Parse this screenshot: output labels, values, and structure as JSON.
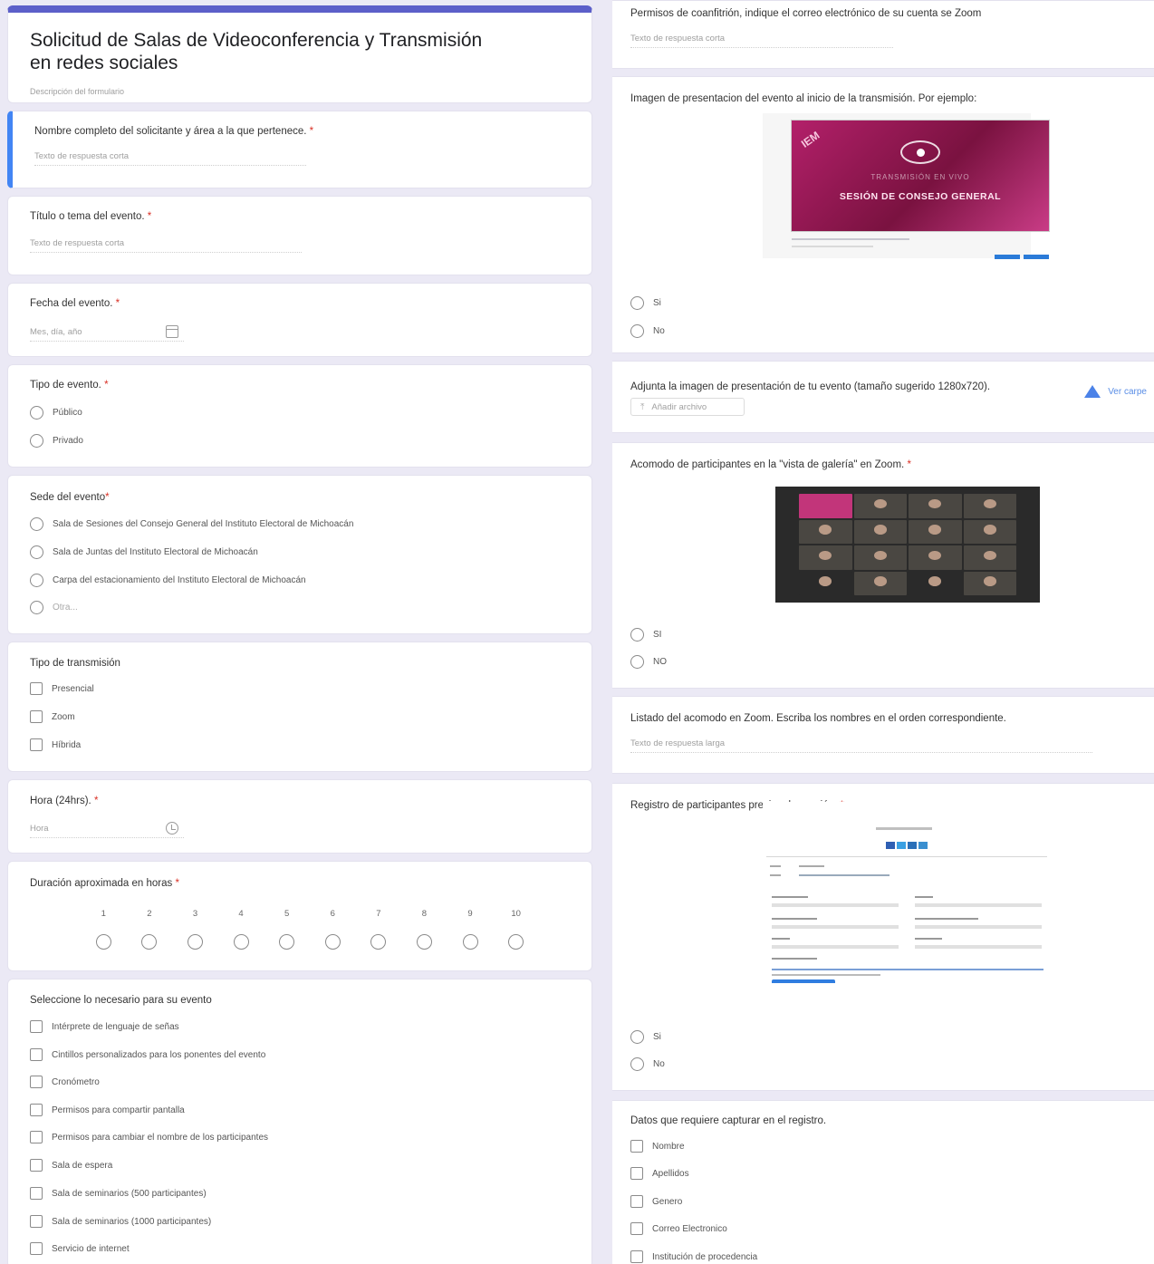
{
  "form": {
    "title": "Solicitud de Salas de Videoconferencia y Transmisión en redes sociales",
    "description_placeholder": "Descripción del formulario",
    "accent_color": "#5c5fc9"
  },
  "left": {
    "q_name": {
      "title": "Nombre completo del solicitante y área a la que pertenece.",
      "req": "*",
      "answer": "Texto de respuesta corta"
    },
    "q_event_title": {
      "title": "Título o tema del evento.",
      "req": "*",
      "answer": "Texto de respuesta corta"
    },
    "q_date": {
      "title": "Fecha del evento.",
      "req": "*",
      "answer": "Mes, día, año",
      "icon": "calendar-icon"
    },
    "q_type": {
      "title": "Tipo de evento.",
      "req": "*",
      "options": [
        "Público",
        "Privado"
      ]
    },
    "q_venue": {
      "title": "Sede del evento",
      "req": "*",
      "options": [
        "Sala de Sesiones del Consejo General del Instituto Electoral de Michoacán",
        "Sala de Juntas del Instituto Electoral de Michoacán",
        "Carpa del estacionamiento del Instituto Electoral de Michoacán",
        "Otra..."
      ]
    },
    "q_transmission": {
      "title": "Tipo de transmisión",
      "options": [
        "Presencial",
        "Zoom",
        "Híbrida"
      ]
    },
    "q_time": {
      "title": "Hora (24hrs).",
      "req": "*",
      "answer": "Hora",
      "icon": "clock-icon"
    },
    "q_duration": {
      "title": "Duración aproximada en horas",
      "req": "*",
      "scale": [
        "1",
        "2",
        "3",
        "4",
        "5",
        "6",
        "7",
        "8",
        "9",
        "10"
      ]
    },
    "q_needs": {
      "title": "Seleccione lo necesario para su evento",
      "options": [
        "Intérprete de lenguaje de señas",
        "Cintillos personalizados para los ponentes del evento",
        "Cronómetro",
        "Permisos para compartir pantalla",
        "Permisos para cambiar el nombre de los participantes",
        "Sala de espera",
        "Sala de seminarios (500 participantes)",
        "Sala de seminarios (1000 participantes)",
        "Servicio de internet"
      ]
    }
  },
  "right": {
    "q_cohost": {
      "title": "Permisos de coanfitrión, indique el correo electrónico de su cuenta se Zoom",
      "answer": "Texto de respuesta corta"
    },
    "q_image": {
      "title": "Imagen de presentacion del evento al inicio de la transmisión. Por ejemplo:",
      "banner_logo": "IEM",
      "banner_sub": "TRANSMISIÓN EN VIVO",
      "banner_text": "SESIÓN DE CONSEJO GENERAL",
      "options": [
        "Si",
        "No"
      ]
    },
    "q_attach": {
      "title": "Adjunta la imagen de presentación de tu evento (tamaño sugerido 1280x720).",
      "upload_label": "Añadir archivo",
      "drive_label": "Ver carpe"
    },
    "q_gallery": {
      "title": "Acomodo de participantes en la \"vista de galería\" en Zoom.",
      "req": "*",
      "options": [
        "SI",
        "NO"
      ]
    },
    "q_list": {
      "title": "Listado del acomodo en Zoom. Escriba los nombres en el orden correspondiente.",
      "answer": "Texto de respuesta larga"
    },
    "q_registration": {
      "title": "Registro de participantes previo a la reunión.",
      "req": "*",
      "options": [
        "Si",
        "No"
      ]
    },
    "q_reg_data": {
      "title": "Datos que requiere capturar en el registro.",
      "options": [
        "Nombre",
        "Apellidos",
        "Genero",
        "Correo Electronico",
        "Institución de procedencia"
      ]
    }
  }
}
